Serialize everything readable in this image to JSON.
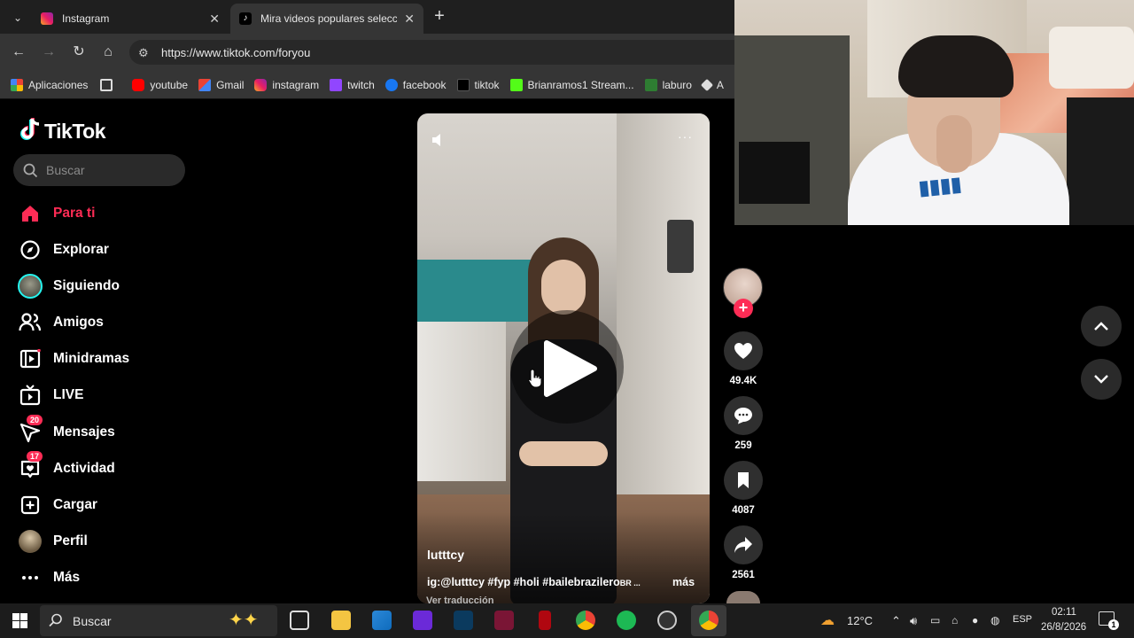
{
  "browser": {
    "tabs": [
      {
        "title": "Instagram",
        "active": false
      },
      {
        "title": "Mira videos populares seleccionados",
        "active": true
      }
    ],
    "url": "https://www.tiktok.com/foryou",
    "bookmarks": [
      "Aplicaciones",
      "youtube",
      "Gmail",
      "instagram",
      "twitch",
      "facebook",
      "tiktok",
      "Brianramos1 Stream...",
      "laburo",
      "A"
    ]
  },
  "tiktok": {
    "logo": "TikTok",
    "search_placeholder": "Buscar",
    "nav": [
      {
        "label": "Para ti",
        "icon": "home-icon",
        "active": true
      },
      {
        "label": "Explorar",
        "icon": "compass-icon"
      },
      {
        "label": "Siguiendo",
        "icon": "following-avatar-icon"
      },
      {
        "label": "Amigos",
        "icon": "friends-icon"
      },
      {
        "label": "Minidramas",
        "icon": "film-icon"
      },
      {
        "label": "LIVE",
        "icon": "live-tv-icon"
      },
      {
        "label": "Mensajes",
        "icon": "messages-icon",
        "badge": "20"
      },
      {
        "label": "Actividad",
        "icon": "activity-icon",
        "badge": "17"
      },
      {
        "label": "Cargar",
        "icon": "upload-icon"
      },
      {
        "label": "Perfil",
        "icon": "profile-avatar-icon"
      },
      {
        "label": "Más",
        "icon": "more-icon"
      }
    ],
    "video": {
      "author": "lutttcy",
      "caption": "ig:@lutttcy #fyp #holi #bailebrazilero",
      "caption_suffix": "BR ...",
      "more_label": "más",
      "translation_hint": "Ver traducción"
    },
    "actions": {
      "likes": "49.4K",
      "comments": "259",
      "saves": "4087",
      "shares": "2561"
    },
    "colors": {
      "accent": "#fe2c55"
    }
  },
  "taskbar": {
    "search_placeholder": "Buscar",
    "weather": "12°C",
    "language": "ESP",
    "time": "02:11",
    "date": "26/8/2026",
    "notifications": "1"
  }
}
